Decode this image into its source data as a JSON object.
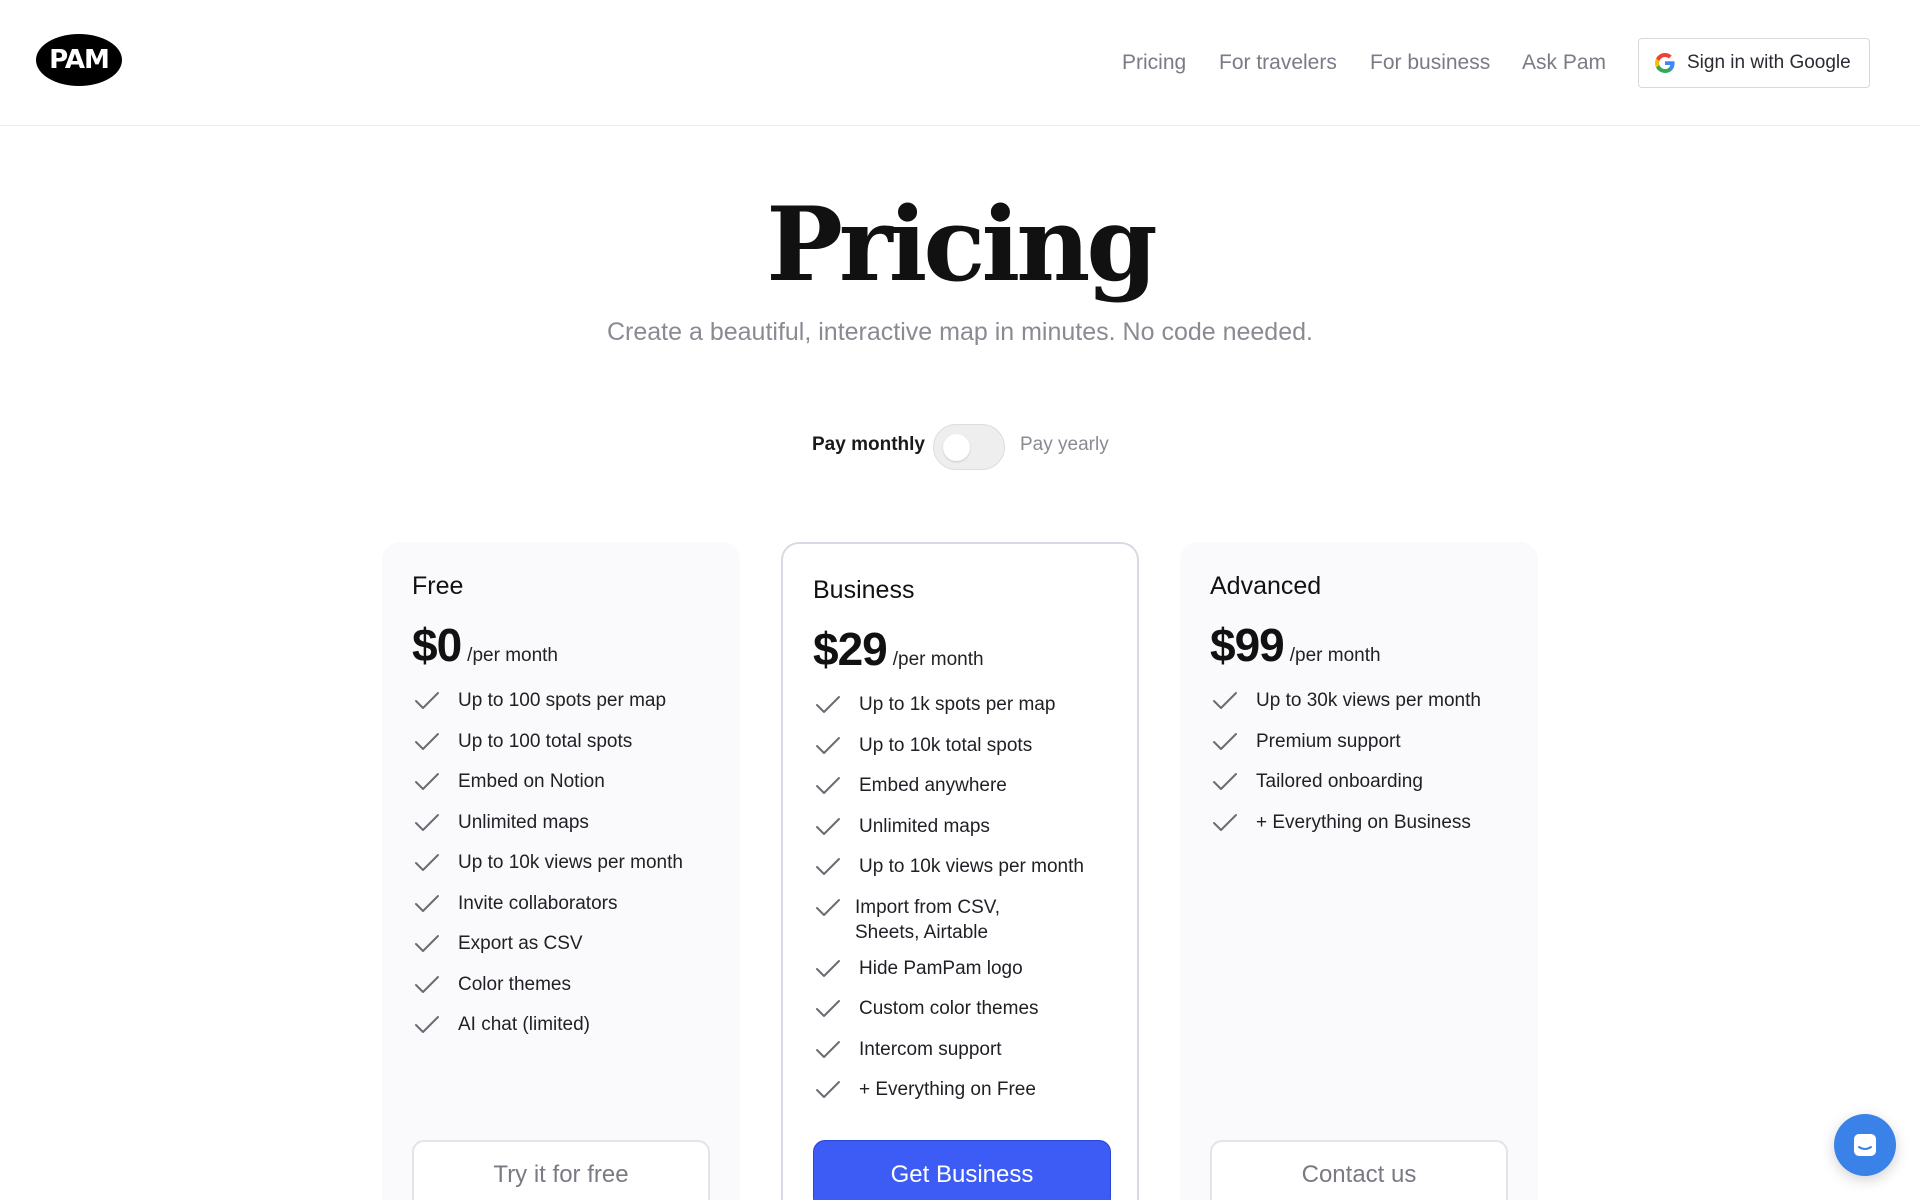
{
  "header": {
    "logo_text": "PAM",
    "nav": [
      "Pricing",
      "For travelers",
      "For business",
      "Ask Pam"
    ],
    "signin_label": "Sign in with Google"
  },
  "hero": {
    "title": "Pricing",
    "subtitle": "Create a beautiful, interactive map in minutes. No code needed."
  },
  "billing_toggle": {
    "left_label": "Pay monthly",
    "right_label": "Pay yearly",
    "state": "monthly"
  },
  "plans": [
    {
      "name": "Free",
      "price": "$0",
      "period": "/per month",
      "features": [
        "Up to 100 spots per map",
        "Up to 100 total spots",
        "Embed on Notion",
        "Unlimited maps",
        "Up to 10k views per month",
        "Invite collaborators",
        "Export as CSV",
        "Color themes",
        "AI chat (limited)"
      ],
      "cta": "Try it for free"
    },
    {
      "name": "Business",
      "price": "$29",
      "period": "/per month",
      "features": [
        "Up to 1k spots per map",
        "Up to 10k total spots",
        "Embed anywhere",
        "Unlimited maps",
        "Up to 10k views per month",
        "Import from CSV,\nSheets, Airtable",
        "Hide PamPam logo",
        "Custom color themes",
        "Intercom support",
        "+ Everything on Free"
      ],
      "cta": "Get Business"
    },
    {
      "name": "Advanced",
      "price": "$99",
      "period": "/per month",
      "features": [
        "Up to 30k views per month",
        "Premium support",
        "Tailored onboarding",
        "+ Everything on Business"
      ],
      "cta": "Contact us"
    }
  ],
  "colors": {
    "primary_button": "#3d5cf5",
    "chat_bubble": "#3b82e8",
    "muted_text": "#8a8a93"
  },
  "icons": {
    "check": "check-icon",
    "google": "google-g-icon",
    "chat": "chat-icon"
  }
}
